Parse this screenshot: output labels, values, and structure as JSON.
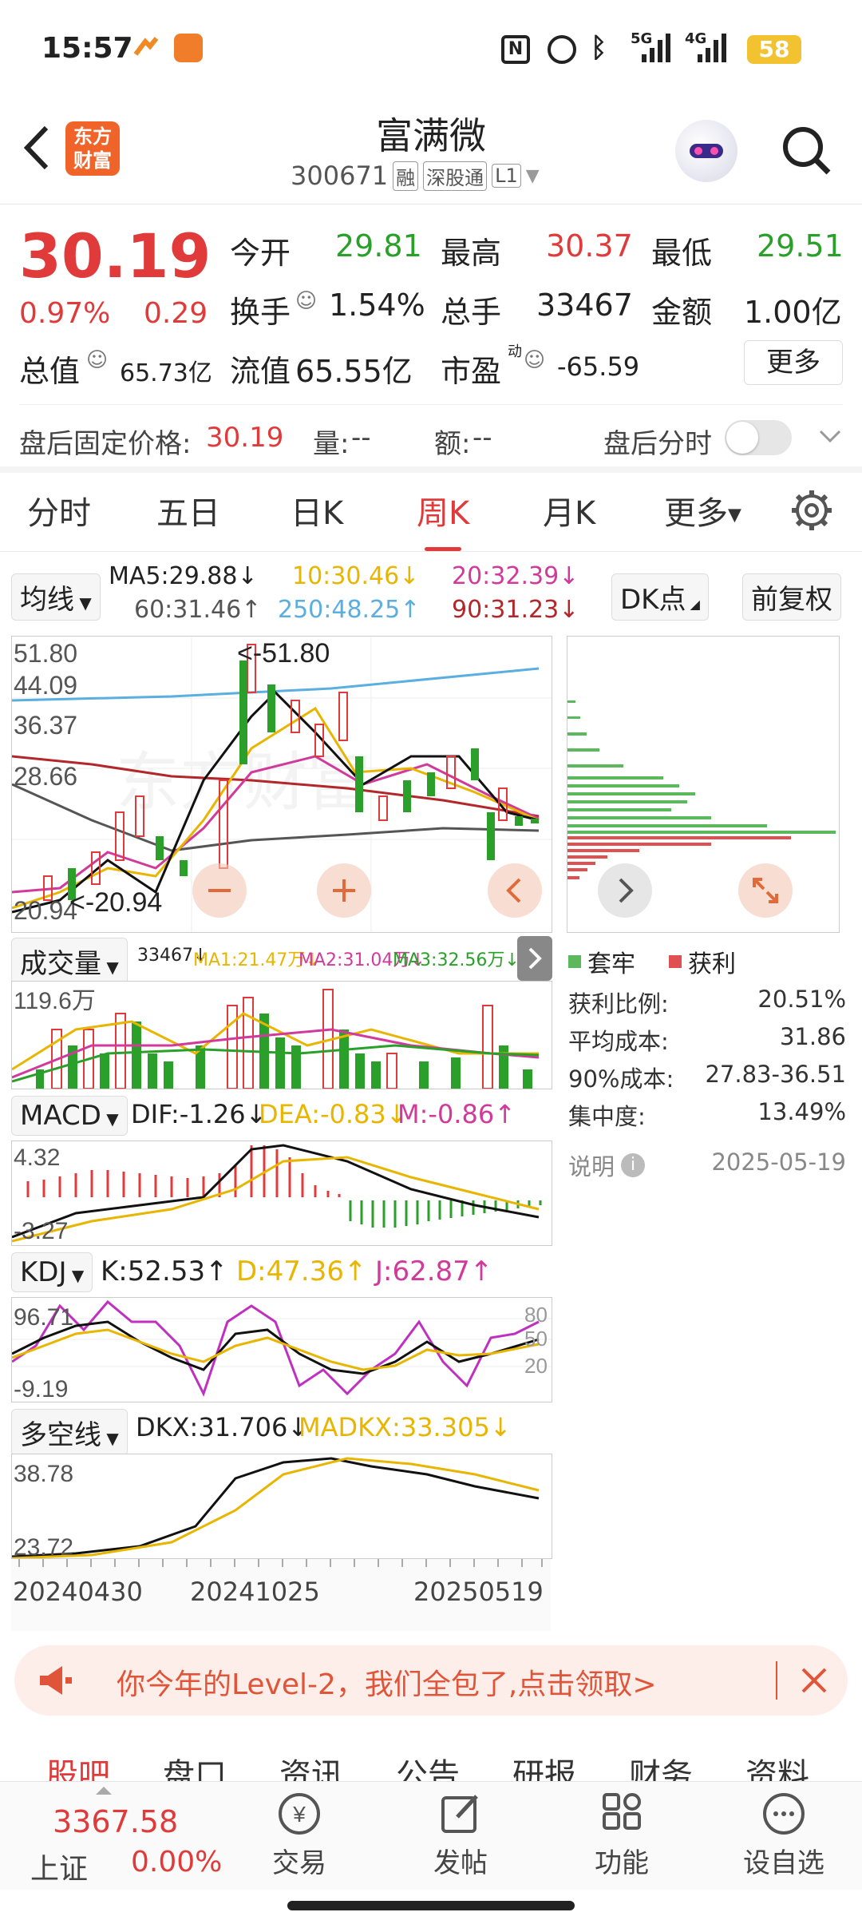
{
  "status": {
    "time": "15:57",
    "battery": "58",
    "net1": "5G",
    "net2": "4G",
    "icons": [
      "nfc-icon",
      "alarm-icon",
      "bluetooth-icon",
      "signal-5g-icon",
      "signal-4g-icon",
      "battery-icon"
    ]
  },
  "header": {
    "title": "富满微",
    "code": "300671",
    "tags": [
      "融",
      "深股通",
      "L1"
    ],
    "brand": "东方\n财富",
    "brand_line1": "东方",
    "brand_line2": "财富"
  },
  "quote": {
    "price": "30.19",
    "change_pct": "0.97%",
    "change": "0.29",
    "open_label": "今开",
    "open": "29.81",
    "high_label": "最高",
    "high": "30.37",
    "low_label": "最低",
    "low": "29.51",
    "turnover_label": "换手",
    "turnover": "1.54%",
    "volume_label": "总手",
    "volume": "33467",
    "amount_label": "金额",
    "amount": "1.00亿",
    "total_mv_label": "总值",
    "total_mv": "65.73亿",
    "float_mv_label": "流值",
    "float_mv": "65.55亿",
    "pe_label": "市盈",
    "pe_sup": "动",
    "pe": "-65.59",
    "more": "更多"
  },
  "afterhours": {
    "price_label": "盘后固定价格:",
    "price": "30.19",
    "vol_label": "量:",
    "vol": "--",
    "amt_label": "额:",
    "amt": "--",
    "timeshare_label": "盘后分时"
  },
  "tabs": [
    "分时",
    "五日",
    "日K",
    "周K",
    "月K",
    "更多"
  ],
  "active_tab": "周K",
  "ma": {
    "selector": "均线",
    "ma5": "MA5:29.88↓",
    "ma10": "10:30.46↓",
    "ma20": "20:32.39↓",
    "ma60": "60:31.46↑",
    "ma250": "250:48.25↑",
    "ma90": "90:31.23↓",
    "dk_btn": "DK点",
    "adjust_btn": "前复权",
    "colors": {
      "ma5": "#222222",
      "ma10": "#e8b500",
      "ma20": "#d13a9b",
      "ma60": "#555555",
      "ma250": "#5aaee0",
      "ma90": "#b3262a"
    }
  },
  "kchart": {
    "ylabels": [
      "51.80",
      "44.09",
      "36.37",
      "28.66",
      "20.94"
    ],
    "high_mark": "<-51.80",
    "low_mark": "<-20.94"
  },
  "chip": {
    "legend_trapped": "套牢",
    "legend_profit": "获利",
    "rows": [
      {
        "label": "获利比例:",
        "value": "20.51%"
      },
      {
        "label": "平均成本:",
        "value": "31.86"
      },
      {
        "label": "90%成本:",
        "value": "27.83-36.51"
      },
      {
        "label": "集中度:",
        "value": "13.49%"
      }
    ],
    "note_label": "说明",
    "date": "2025-05-19"
  },
  "volume": {
    "selector": "成交量",
    "val": "33467↓",
    "ma1": "MA1:21.47万↓",
    "ma2": "MA2:31.04万↓",
    "ma3": "MA3:32.56万↓",
    "ylabel": "119.6万"
  },
  "macd": {
    "selector": "MACD",
    "dif": "DIF:-1.26↓",
    "dea": "DEA:-0.83↓",
    "m": "M:-0.86↑",
    "ytop": "4.32",
    "ybot": "-3.27"
  },
  "kdj": {
    "selector": "KDJ",
    "k": "K:52.53↑",
    "d": "D:47.36↑",
    "j": "J:62.87↑",
    "ytop": "96.71",
    "ybot": "-9.19",
    "lv80": "80",
    "lv50": "50",
    "lv20": "20"
  },
  "dkx": {
    "selector": "多空线",
    "dkx": "DKX:31.706↓",
    "madkx": "MADKX:33.305↓",
    "ytop": "38.78",
    "ybot": "23.72"
  },
  "xaxis": [
    "20240430",
    "20241025",
    "20250519"
  ],
  "banner": {
    "text": "你今年的Level-2，我们全包了,点击领取>"
  },
  "bottom_tabs": [
    "股吧",
    "盘口",
    "资讯",
    "公告",
    "研报",
    "财务",
    "资料"
  ],
  "bottom_bar": {
    "index_value": "3367.58",
    "index_name": "上证",
    "index_change": "0.00%",
    "items": [
      "交易",
      "发帖",
      "功能",
      "设自选"
    ]
  }
}
